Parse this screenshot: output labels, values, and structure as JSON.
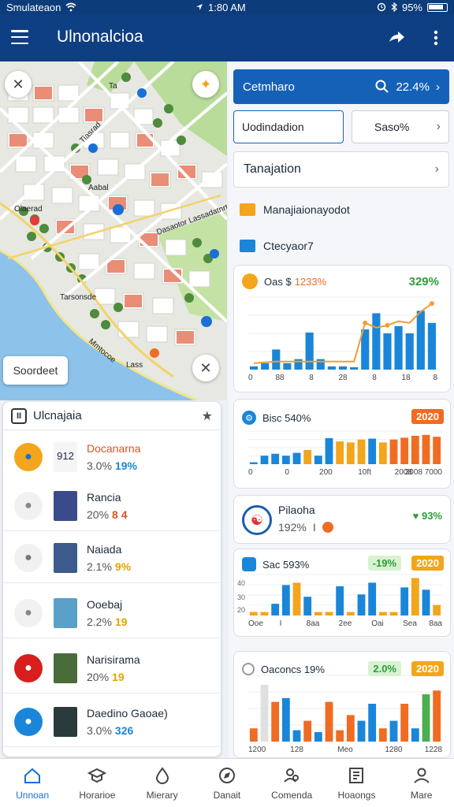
{
  "status_bar": {
    "carrier": "Smulateaon",
    "time": "1:80 AM",
    "battery": "95%"
  },
  "app_bar": {
    "title": "Ulnonalcioa"
  },
  "map": {
    "labels": [
      "Olaerad",
      "Ta",
      "Tiasrad",
      "Aabal",
      "Dasaotor Lassadatnrt",
      "Tarsonsde",
      "Mmtocoe",
      "Lass"
    ],
    "label_box": "Soordeet"
  },
  "list": {
    "title": "Ulcnajaia",
    "items": [
      {
        "title": "Docanarna",
        "sub": "3.0%",
        "value": "19%",
        "value_color": "#1a86d9",
        "title_color": "#d9541e",
        "badge": "912",
        "circle_bg": "#f3a51b",
        "circle_fg": "#1a6fd6",
        "icon": "compass-icon",
        "thumb": "#f5f5f5"
      },
      {
        "title": "Rancia",
        "sub": "20%",
        "value": "8 4",
        "value_color": "#d9541e",
        "title_color": "#1d2a3a",
        "circle_bg": "#f1f1f1",
        "circle_fg": "#888",
        "icon": "tools-icon",
        "thumb": "#3a4a8a"
      },
      {
        "title": "Naiada",
        "sub": "2.1%",
        "value": "9%",
        "value_color": "#e2a400",
        "title_color": "#1d2a3a",
        "circle_bg": "#f1f1f1",
        "circle_fg": "#777",
        "icon": "close-icon",
        "thumb": "#3d5a8c"
      },
      {
        "title": "Ooebaj",
        "sub": "2.2%",
        "value": "19",
        "value_color": "#e2a400",
        "title_color": "#1d2a3a",
        "circle_bg": "#f1f1f1",
        "circle_fg": "#888",
        "icon": "sparkle-icon",
        "thumb": "#5aa0c8"
      },
      {
        "title": "Narisirama",
        "sub": "20%",
        "value": "19",
        "value_color": "#e2a400",
        "title_color": "#1d2a3a",
        "circle_bg": "#d91e1e",
        "circle_fg": "#fff",
        "icon": "chat-icon",
        "thumb": "#4a6b3a"
      },
      {
        "title": "Daedino Gaoae)",
        "sub": "3.0%",
        "value": "326",
        "value_color": "#1a86d9",
        "title_color": "#1d2a3a",
        "circle_bg": "#1a86d9",
        "circle_fg": "#fff",
        "icon": "bird-icon",
        "thumb": "#2b3a3a"
      }
    ]
  },
  "right": {
    "search": {
      "label": "Cetmharo",
      "value": "22.4%"
    },
    "field_a": "Uodindadion",
    "field_b": "Saso%",
    "select": "Tanajation",
    "menu": [
      {
        "label": "Manajiaionayodot",
        "color": "#f3a51b"
      },
      {
        "label": "Ctecyaor7",
        "color": "#1a86d9"
      }
    ],
    "chart1": {
      "left": "Oas $",
      "right_val": "1233%",
      "badge": "329%"
    },
    "chart2": {
      "left": "Bisc 540%",
      "badge": "2020"
    },
    "profile": {
      "name": "Pilaoha",
      "sub": "192%",
      "sub2": "I",
      "badge": "93%"
    },
    "chart3": {
      "left": "Sac 593%",
      "badge_a": "-19%",
      "badge_b": "2020"
    },
    "chart4": {
      "left": "Oaconcs 19%",
      "badge_a": "2.0%",
      "badge_b": "2020"
    }
  },
  "chart_data": [
    {
      "type": "bar",
      "title": "Oas $ 1233%",
      "categories": [
        "0",
        "1",
        "2",
        "3",
        "4",
        "5",
        "6",
        "7",
        "8",
        "9",
        "10",
        "11",
        "12",
        "13",
        "14",
        "15",
        "16"
      ],
      "x_tick_labels": [
        "0",
        "88",
        "8",
        "28",
        "8",
        "18",
        "8"
      ],
      "series": [
        {
          "values": [
            4,
            8,
            25,
            8,
            13,
            46,
            13,
            4,
            4,
            3,
            50,
            70,
            45,
            54,
            45,
            73,
            58
          ],
          "color": "#1a86d9"
        }
      ],
      "line": [
        8,
        9,
        10,
        10,
        10,
        10,
        10,
        10,
        10,
        10,
        58,
        52,
        55,
        60,
        58,
        72,
        82
      ],
      "ylim": [
        0,
        90
      ]
    },
    {
      "type": "bar",
      "title": "Bisc 540%",
      "categories": [
        "0",
        "1",
        "2",
        "3",
        "4",
        "5",
        "6",
        "7",
        "8",
        "9",
        "10",
        "11",
        "12",
        "13",
        "14",
        "15",
        "16",
        "17"
      ],
      "x_tick_labels": [
        "0",
        "0",
        "200",
        "10ft",
        "2008",
        "2008 7000"
      ],
      "series": [
        {
          "values": [
            4,
            18,
            22,
            18,
            24,
            30,
            18,
            55,
            48,
            46,
            52,
            54,
            46,
            52,
            56,
            60,
            62,
            58
          ],
          "colors": [
            "#1a86d9",
            "#1a86d9",
            "#1a86d9",
            "#1a86d9",
            "#1a86d9",
            "#f3a51b",
            "#1a86d9",
            "#1a86d9",
            "#f3a51b",
            "#f3a51b",
            "#f3a51b",
            "#1a86d9",
            "#f3a51b",
            "#f06c22",
            "#f06c22",
            "#f06c22",
            "#f06c22",
            "#f06c22"
          ]
        }
      ],
      "ylim": [
        0,
        70
      ]
    },
    {
      "type": "bar",
      "title": "Sac 593%",
      "categories": [
        "0",
        "1",
        "2",
        "3",
        "4",
        "5",
        "6",
        "7",
        "8",
        "9",
        "10",
        "11",
        "12",
        "13",
        "14",
        "15",
        "16",
        "17"
      ],
      "x_tick_labels": [
        "Ooe",
        "I",
        "8aa",
        "2ee",
        "Oai",
        "Sea",
        "8aa"
      ],
      "series": [
        {
          "values": [
            6,
            6,
            20,
            52,
            56,
            32,
            6,
            6,
            50,
            6,
            36,
            56,
            6,
            6,
            48,
            64,
            44,
            18
          ],
          "colors": [
            "#f3a51b",
            "#f3a51b",
            "#1a86d9",
            "#1a86d9",
            "#f3a51b",
            "#1a86d9",
            "#f3a51b",
            "#f3a51b",
            "#1a86d9",
            "#f3a51b",
            "#1a86d9",
            "#1a86d9",
            "#f3a51b",
            "#f3a51b",
            "#1a86d9",
            "#f3a51b",
            "#1a86d9",
            "#f3a51b"
          ]
        }
      ],
      "ylim": [
        0,
        70
      ]
    },
    {
      "type": "bar",
      "title": "Oaconcs 19%",
      "categories": [
        "0",
        "1",
        "2",
        "3",
        "4",
        "5",
        "6",
        "7",
        "8",
        "9",
        "10",
        "11",
        "12",
        "13",
        "14",
        "15",
        "16",
        "17"
      ],
      "x_tick_labels": [
        "1200",
        "128",
        "Meo",
        "1280",
        "1228"
      ],
      "series": [
        {
          "values": [
            14,
            60,
            42,
            46,
            12,
            22,
            10,
            42,
            12,
            28,
            22,
            40,
            14,
            22,
            40,
            14,
            50,
            54
          ],
          "colors": [
            "#f06c22",
            "#e0e0e0",
            "#f06c22",
            "#1a86d9",
            "#1a86d9",
            "#f06c22",
            "#1a86d9",
            "#f06c22",
            "#f06c22",
            "#f06c22",
            "#1a86d9",
            "#1a86d9",
            "#f06c22",
            "#1a86d9",
            "#f06c22",
            "#1a86d9",
            "#4caf50",
            "#f06c22"
          ]
        }
      ],
      "ylim": [
        0,
        70
      ]
    }
  ],
  "bottom_nav": [
    {
      "label": "Unnoan",
      "icon": "home-icon",
      "active": true
    },
    {
      "label": "Horarioe",
      "icon": "education-icon",
      "active": false
    },
    {
      "label": "Mierary",
      "icon": "drop-icon",
      "active": false
    },
    {
      "label": "Danait",
      "icon": "compass-icon",
      "active": false
    },
    {
      "label": "Comenda",
      "icon": "profile-search-icon",
      "active": false
    },
    {
      "label": "Hoaongs",
      "icon": "document-icon",
      "active": false
    },
    {
      "label": "Mare",
      "icon": "user-icon",
      "active": false
    }
  ]
}
